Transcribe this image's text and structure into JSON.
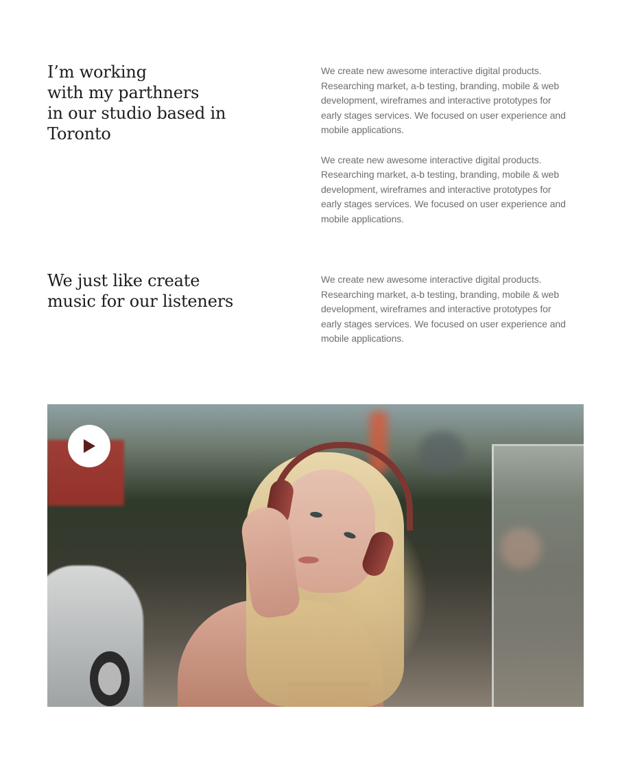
{
  "intro": {
    "heading_lines": [
      "I’m working",
      "with my parthners",
      "in our studio based in",
      "Toronto"
    ],
    "paragraphs": [
      [
        "We create new awesome interactive digital products.",
        "Researching market, a-b testing, branding, mobile & web",
        "development, wireframes and interactive prototypes for",
        "early stages services. We focused on user experience and",
        "mobile applications."
      ],
      [
        "We create new awesome interactive digital products.",
        "Researching market, a-b testing, branding, mobile & web",
        "development, wireframes and interactive prototypes for",
        "early stages services. We focused on user experience and",
        "mobile applications."
      ]
    ]
  },
  "music": {
    "heading_lines": [
      "We just like create",
      "music for our listeners"
    ],
    "paragraphs": [
      [
        "We create new awesome interactive digital products.",
        "Researching market, a-b testing, branding, mobile & web",
        "development, wireframes and interactive prototypes for",
        "early stages services. We focused on user experience and",
        "mobile applications."
      ]
    ]
  },
  "video": {
    "play_icon": "play-icon",
    "play_icon_color": "#5a1f1c",
    "button_color": "#ffffff"
  }
}
